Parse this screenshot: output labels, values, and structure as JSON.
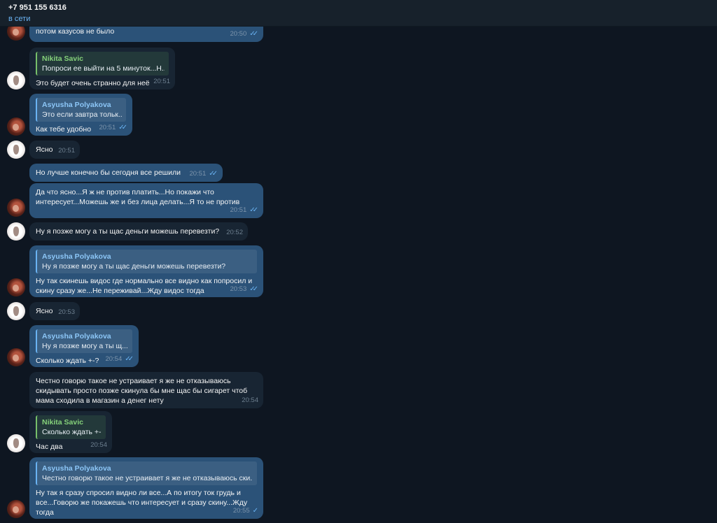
{
  "header": {
    "name": "+7 951 155 6316",
    "status": "в сети"
  },
  "messages": [
    {
      "text": "потом казусов не было",
      "time": "20:50"
    },
    {
      "reply_name": "Nikita Savic",
      "reply_text": "Попроси ее выйти на 5 минуток...Н...",
      "text": "Это будет очень странно для неё",
      "time": "20:51"
    },
    {
      "reply_name": "Asyusha Polyakova",
      "reply_text": "Это если завтра тольк...",
      "text": "Как тебе удобно",
      "time": "20:51"
    },
    {
      "text": "Ясно",
      "time": "20:51"
    },
    {
      "text": "Но лучше конечно бы сегодня все решили",
      "time": "20:51"
    },
    {
      "text": "Да что ясно...Я ж не против платить...Но покажи что\nинтересует...Можешь же и без лица делать...Я то не против",
      "time": "20:51"
    },
    {
      "text": "Ну я позже могу а ты щас деньги можешь перевезти?",
      "time": "20:52"
    },
    {
      "reply_name": "Asyusha Polyakova",
      "reply_text": "Ну я позже могу а ты щас деньги можешь перевезти?",
      "text": "Ну так скинешь видос где нормально все видно как попросил и\nскину сразу же...Не переживай...Жду видос тогда",
      "time": "20:53"
    },
    {
      "text": "Ясно",
      "time": "20:53"
    },
    {
      "reply_name": "Asyusha Polyakova",
      "reply_text": "Ну я позже могу а ты щ...",
      "text": "Сколько ждать +-?",
      "time": "20:54"
    },
    {
      "text": "Честно говорю такое не устраивает я же не отказываюсь\nскидывать просто позже скинула бы мне щас бы сигарет чтоб\nмама сходила в магазин а денег нету",
      "time": "20:54"
    },
    {
      "reply_name": "Nikita Savic",
      "reply_text": "Сколько ждать +-?",
      "text": "Час два",
      "time": "20:54"
    },
    {
      "reply_name": "Asyusha Polyakova",
      "reply_text": "Честно говорю такое не устраивает я же не отказываюсь ски...",
      "text": "Ну так я сразу спросил видно ли все...А по итогу ток грудь и\nвсе...Говорю же покажешь что интересует и сразу скину...Жду\nтогда",
      "time": "20:55"
    }
  ],
  "icons": {
    "read": "double-check-icon",
    "sent": "single-check-icon"
  },
  "colors": {
    "background": "#0e1621",
    "header": "#17212b",
    "outgoing": "#2b5278",
    "incoming": "#182533",
    "accent": "#6ab3f3",
    "reply_green": "#77c06a"
  }
}
